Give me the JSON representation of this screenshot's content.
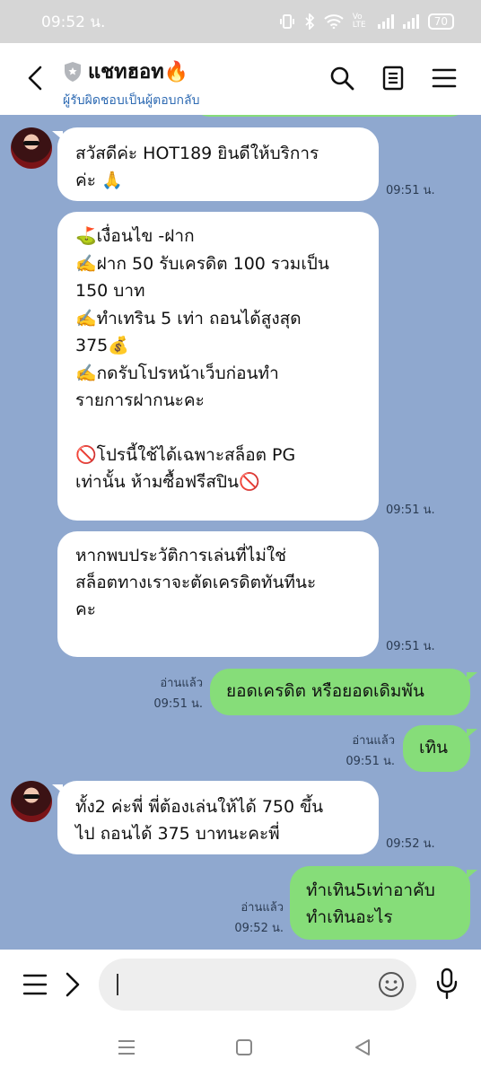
{
  "status_bar": {
    "time": "09:52 น.",
    "battery": "70",
    "volte": "Vo LTE"
  },
  "header": {
    "title": "แชทฮอท🔥",
    "subtitle": "ผู้รับผิดชอบเป็นผู้ตอบกลับ"
  },
  "messages": [
    {
      "lines": [
        "สวัสดีค่ะ HOT189  ยินดีให้บริการ",
        "ค่ะ 🙏"
      ],
      "time": "09:51 น."
    },
    {
      "lines": [
        "⛳เงื่อนไข -ฝาก",
        "✍️ฝาก 50 รับเครดิต 100 รวมเป็น",
        "150 บาท",
        "✍️ทำเทริน 5 เท่า ถอนได้สูงสุด",
        "375💰",
        "✍️กดรับโปรหน้าเว็บก่อนทำ",
        "รายการฝากนะคะ",
        "",
        "🚫โปรนี้ใช้ได้เฉพาะสล็อต PG",
        "เท่านั้น ห้ามซื้อฟรีสปิน🚫"
      ],
      "time": "09:51 น."
    },
    {
      "lines": [
        "หากพบประวัติการเล่นที่ไม่ใช่",
        "สล็อตทางเราจะตัดเครดิตทันทีนะ",
        "คะ"
      ],
      "time": "09:51 น."
    },
    {
      "lines": [
        "ยอดเครดิต หรือยอดเดิมพัน"
      ],
      "time": "09:51 น.",
      "read": "อ่านแล้ว"
    },
    {
      "lines": [
        "เทิน"
      ],
      "time": "09:51 น.",
      "read": "อ่านแล้ว"
    },
    {
      "lines": [
        "ทั้ง2 ค่ะพี่ พี่ต้องเล่นให้ได้ 750 ขึ้น",
        "ไป ถอนได้ 375 บาทนะคะพี่"
      ],
      "time": "09:52 น."
    },
    {
      "lines": [
        "ทำเทิน5เท่าอาคับ",
        "ทำเทินอะไร"
      ],
      "time": "09:52 น.",
      "read": "อ่านแล้ว"
    }
  ],
  "input": {
    "value": ""
  },
  "colors": {
    "chat_bg": "#8fa8cf",
    "sent_bubble": "#86dd79",
    "received_bubble": "#ffffff",
    "link_blue": "#2f6bb3"
  }
}
